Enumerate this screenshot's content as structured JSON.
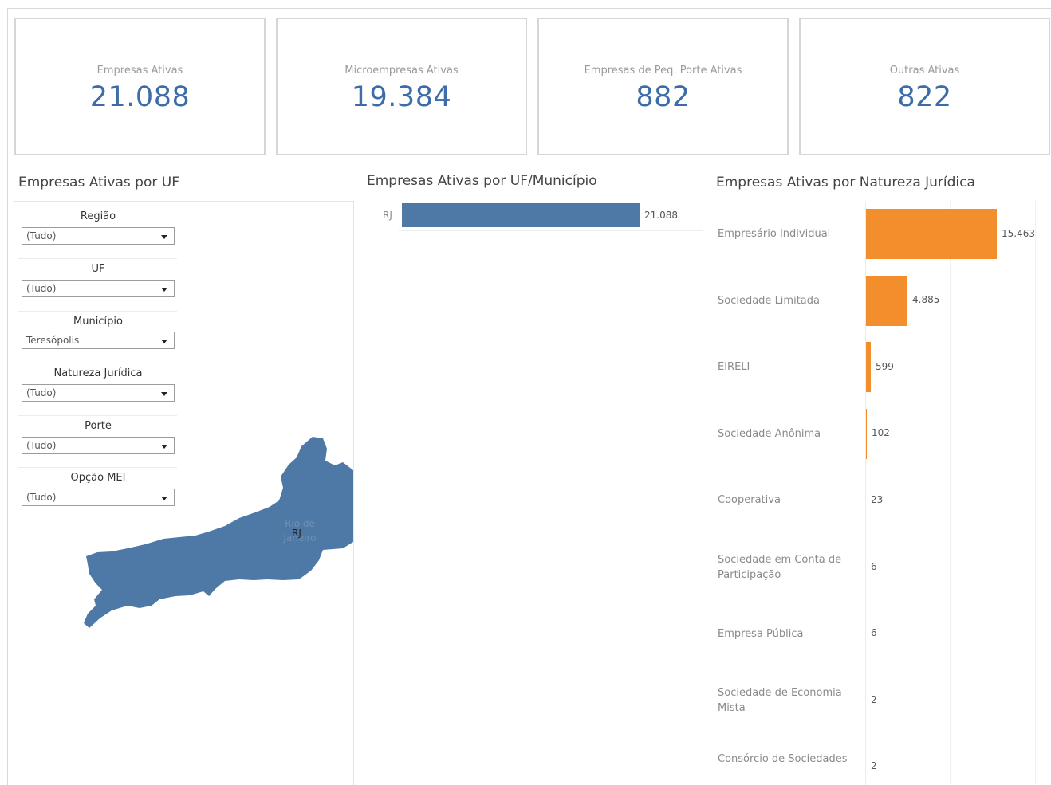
{
  "kpis": [
    {
      "label": "Empresas Ativas",
      "value": "21.088"
    },
    {
      "label": "Microempresas Ativas",
      "value": "19.384"
    },
    {
      "label": "Empresas de Peq. Porte Ativas",
      "value": "882"
    },
    {
      "label": "Outras Ativas",
      "value": "822"
    }
  ],
  "sections": {
    "uf_title": "Empresas Ativas por UF",
    "municipio_title": "Empresas Ativas por UF/Município",
    "natureza_title": "Empresas Ativas por Natureza Jurídica"
  },
  "filters": [
    {
      "label": "Região",
      "value": "(Tudo)"
    },
    {
      "label": "UF",
      "value": "(Tudo)"
    },
    {
      "label": "Município",
      "value": "Teresópolis"
    },
    {
      "label": "Natureza Jurídica",
      "value": "(Tudo)"
    },
    {
      "label": "Porte",
      "value": "(Tudo)"
    },
    {
      "label": "Opção MEI",
      "value": "(Tudo)"
    }
  ],
  "map": {
    "state_name": "Rio de Janeiro",
    "state_code": "RJ",
    "fill_color": "#4e79a7"
  },
  "colors": {
    "blue": "#4e79a7",
    "orange": "#f28e2b",
    "kpi_value": "#3d6da8"
  },
  "chart_data": [
    {
      "type": "bar",
      "orientation": "horizontal",
      "title": "Empresas Ativas por UF/Município",
      "categories": [
        "RJ"
      ],
      "values": [
        21088
      ],
      "labels": [
        "21.088"
      ],
      "xlim": [
        0,
        21088
      ]
    },
    {
      "type": "bar",
      "orientation": "horizontal",
      "title": "Empresas Ativas por Natureza Jurídica",
      "categories": [
        "Empresário Individual",
        "Sociedade Limitada",
        "EIRELI",
        "Sociedade Anônima",
        "Cooperativa",
        "Sociedade em Conta de Participação",
        "Empresa Pública",
        "Sociedade de Economia Mista",
        "Consórcio de Sociedades"
      ],
      "values": [
        15463,
        4885,
        599,
        102,
        23,
        6,
        6,
        2,
        2
      ],
      "labels": [
        "15.463",
        "4.885",
        "599",
        "102",
        "23",
        "6",
        "6",
        "2",
        "2"
      ],
      "xlim": [
        0,
        20000
      ]
    }
  ]
}
